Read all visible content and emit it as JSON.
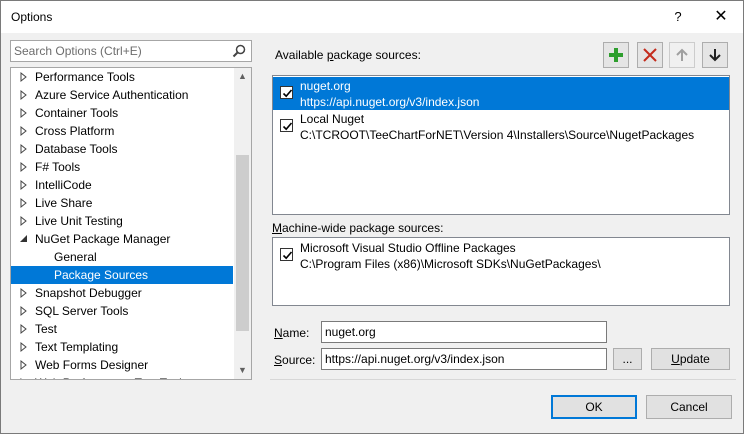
{
  "window": {
    "title": "Options",
    "help_label": "?",
    "close_label": "✕"
  },
  "search": {
    "placeholder": "Search Options (Ctrl+E)",
    "icon": "search-icon"
  },
  "tree": {
    "items": [
      {
        "label": "Performance Tools",
        "expanded": false,
        "child": false,
        "selected": false
      },
      {
        "label": "Azure Service Authentication",
        "expanded": false,
        "child": false,
        "selected": false
      },
      {
        "label": "Container Tools",
        "expanded": false,
        "child": false,
        "selected": false
      },
      {
        "label": "Cross Platform",
        "expanded": false,
        "child": false,
        "selected": false
      },
      {
        "label": "Database Tools",
        "expanded": false,
        "child": false,
        "selected": false
      },
      {
        "label": "F# Tools",
        "expanded": false,
        "child": false,
        "selected": false
      },
      {
        "label": "IntelliCode",
        "expanded": false,
        "child": false,
        "selected": false
      },
      {
        "label": "Live Share",
        "expanded": false,
        "child": false,
        "selected": false
      },
      {
        "label": "Live Unit Testing",
        "expanded": false,
        "child": false,
        "selected": false
      },
      {
        "label": "NuGet Package Manager",
        "expanded": true,
        "child": false,
        "selected": false
      },
      {
        "label": "General",
        "expanded": null,
        "child": true,
        "selected": false
      },
      {
        "label": "Package Sources",
        "expanded": null,
        "child": true,
        "selected": true
      },
      {
        "label": "Snapshot Debugger",
        "expanded": false,
        "child": false,
        "selected": false
      },
      {
        "label": "SQL Server Tools",
        "expanded": false,
        "child": false,
        "selected": false
      },
      {
        "label": "Test",
        "expanded": false,
        "child": false,
        "selected": false
      },
      {
        "label": "Text Templating",
        "expanded": false,
        "child": false,
        "selected": false
      },
      {
        "label": "Web Forms Designer",
        "expanded": false,
        "child": false,
        "selected": false
      },
      {
        "label": "Web Performance Test Tools",
        "expanded": false,
        "child": false,
        "selected": false
      }
    ]
  },
  "available": {
    "label_pre": "Available ",
    "label_key": "p",
    "label_post": "ackage sources:",
    "add_icon": "plus-icon",
    "remove_icon": "delete-icon",
    "up_icon": "arrow-up-icon",
    "down_icon": "arrow-down-icon",
    "sources": [
      {
        "name": "nuget.org",
        "url": "https://api.nuget.org/v3/index.json",
        "checked": true,
        "selected": true
      },
      {
        "name": "Local Nuget",
        "url": "C:\\TCROOT\\TeeChartForNET\\Version 4\\Installers\\Source\\NugetPackages",
        "checked": true,
        "selected": false
      }
    ]
  },
  "machine_wide": {
    "label_key": "M",
    "label_post": "achine-wide package sources:",
    "sources": [
      {
        "name": "Microsoft Visual Studio Offline Packages",
        "url": "C:\\Program Files (x86)\\Microsoft SDKs\\NuGetPackages\\",
        "checked": true
      }
    ]
  },
  "form": {
    "name_key": "N",
    "name_post": "ame:",
    "name_value": "nuget.org",
    "source_key": "S",
    "source_post": "ource:",
    "source_value": "https://api.nuget.org/v3/index.json",
    "browse_label": "...",
    "update_key": "U",
    "update_post": "pdate"
  },
  "footer": {
    "ok_label": "OK",
    "cancel_label": "Cancel"
  },
  "colors": {
    "selection": "#0078d7",
    "add_green": "#2e9e2e",
    "remove_red": "#c42b1c"
  }
}
